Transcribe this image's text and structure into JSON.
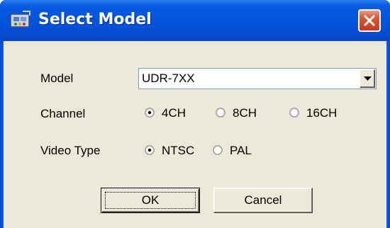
{
  "window": {
    "title": "Select Model",
    "title_icon": "app-icon",
    "close_icon": "close-icon",
    "colors": {
      "titlebar": "#0356e0",
      "client": "#ece9d8",
      "close_button": "#c53b1c"
    }
  },
  "model": {
    "label": "Model",
    "selected": "UDR-7XX",
    "dropdown_icon": "chevron-down-icon"
  },
  "channel": {
    "label": "Channel",
    "options": [
      {
        "label": "4CH",
        "checked": true
      },
      {
        "label": "8CH",
        "checked": false
      },
      {
        "label": "16CH",
        "checked": false
      }
    ]
  },
  "video_type": {
    "label": "Video Type",
    "options": [
      {
        "label": "NTSC",
        "checked": true
      },
      {
        "label": "PAL",
        "checked": false
      }
    ]
  },
  "buttons": {
    "ok_label": "OK",
    "cancel_label": "Cancel"
  }
}
